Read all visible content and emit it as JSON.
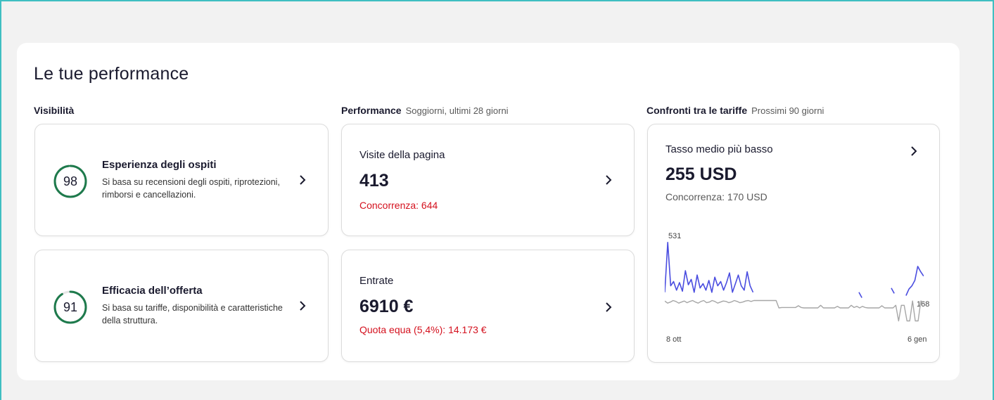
{
  "page": {
    "title": "Le tue performance"
  },
  "visibility": {
    "heading": "Visibilità",
    "cards": [
      {
        "score": "98",
        "score_fraction": 0.98,
        "title": "Esperienza degli ospiti",
        "description": "Si basa su recensioni degli ospiti, riprotezioni, rimborsi e cancellazioni."
      },
      {
        "score": "91",
        "score_fraction": 0.91,
        "title": "Efficacia dell’offerta",
        "description": "Si basa su tariffe, disponibilità e caratteristiche della struttura."
      }
    ]
  },
  "performance": {
    "heading": "Performance",
    "subheading": "Soggiorni, ultimi 28 giorni",
    "cards": [
      {
        "label": "Visite della pagina",
        "value": "413",
        "comparison": "Concorrenza: 644"
      },
      {
        "label": "Entrate",
        "value": "6910 €",
        "comparison": "Quota equa (5,4%): 14.173 €"
      }
    ]
  },
  "rates": {
    "heading": "Confronti tra le tariffe",
    "subheading": "Prossimi 90 giorni",
    "label": "Tasso medio più basso",
    "value": "255 USD",
    "comparison": "Concorrenza: 170 USD"
  },
  "colors": {
    "score_ring": "#1e7a4c",
    "competitor_text": "#d4111e",
    "own_line": "#4a4de0",
    "competitor_line": "#a6a6a6"
  },
  "chart_data": {
    "type": "line",
    "x_start_label": "8 ott",
    "x_end_label": "6 gen",
    "y_max_label": "531",
    "y_min_label": "168",
    "series": [
      {
        "values": [
          300,
          531,
          330,
          350,
          310,
          345,
          305,
          400,
          335,
          360,
          300,
          380,
          320,
          340,
          310,
          355,
          300,
          370,
          330,
          350,
          310,
          345,
          390,
          300,
          340,
          380,
          330,
          310,
          395,
          330,
          300,
          null,
          null,
          null,
          null,
          null,
          null,
          null,
          null,
          null,
          null,
          null,
          null,
          null,
          null,
          null,
          null,
          null,
          null,
          null,
          null,
          null,
          null,
          null,
          null,
          null,
          null,
          null,
          null,
          null,
          null,
          null,
          null,
          null,
          null,
          null,
          300,
          275,
          null,
          null,
          null,
          null,
          290,
          null,
          null,
          null,
          null,
          320,
          295,
          null,
          null,
          null,
          285,
          315,
          330,
          355,
          420,
          395,
          375
        ]
      },
      {
        "values": [
          260,
          250,
          255,
          262,
          258,
          250,
          255,
          260,
          252,
          258,
          262,
          255,
          250,
          258,
          262,
          252,
          255,
          262,
          258,
          250,
          255,
          260,
          258,
          252,
          256,
          262,
          258,
          252,
          255,
          260,
          262,
          258,
          262,
          262,
          262,
          262,
          262,
          262,
          262,
          262,
          262,
          228,
          230,
          230,
          230,
          230,
          230,
          230,
          238,
          230,
          228,
          228,
          228,
          228,
          228,
          228,
          240,
          228,
          228,
          228,
          228,
          228,
          235,
          228,
          228,
          228,
          228,
          240,
          230,
          235,
          228,
          235,
          230,
          228,
          228,
          228,
          228,
          228,
          238,
          228,
          228,
          228,
          228,
          240,
          168,
          240,
          240,
          168,
          168,
          260,
          168,
          168,
          260,
          255
        ]
      }
    ]
  }
}
